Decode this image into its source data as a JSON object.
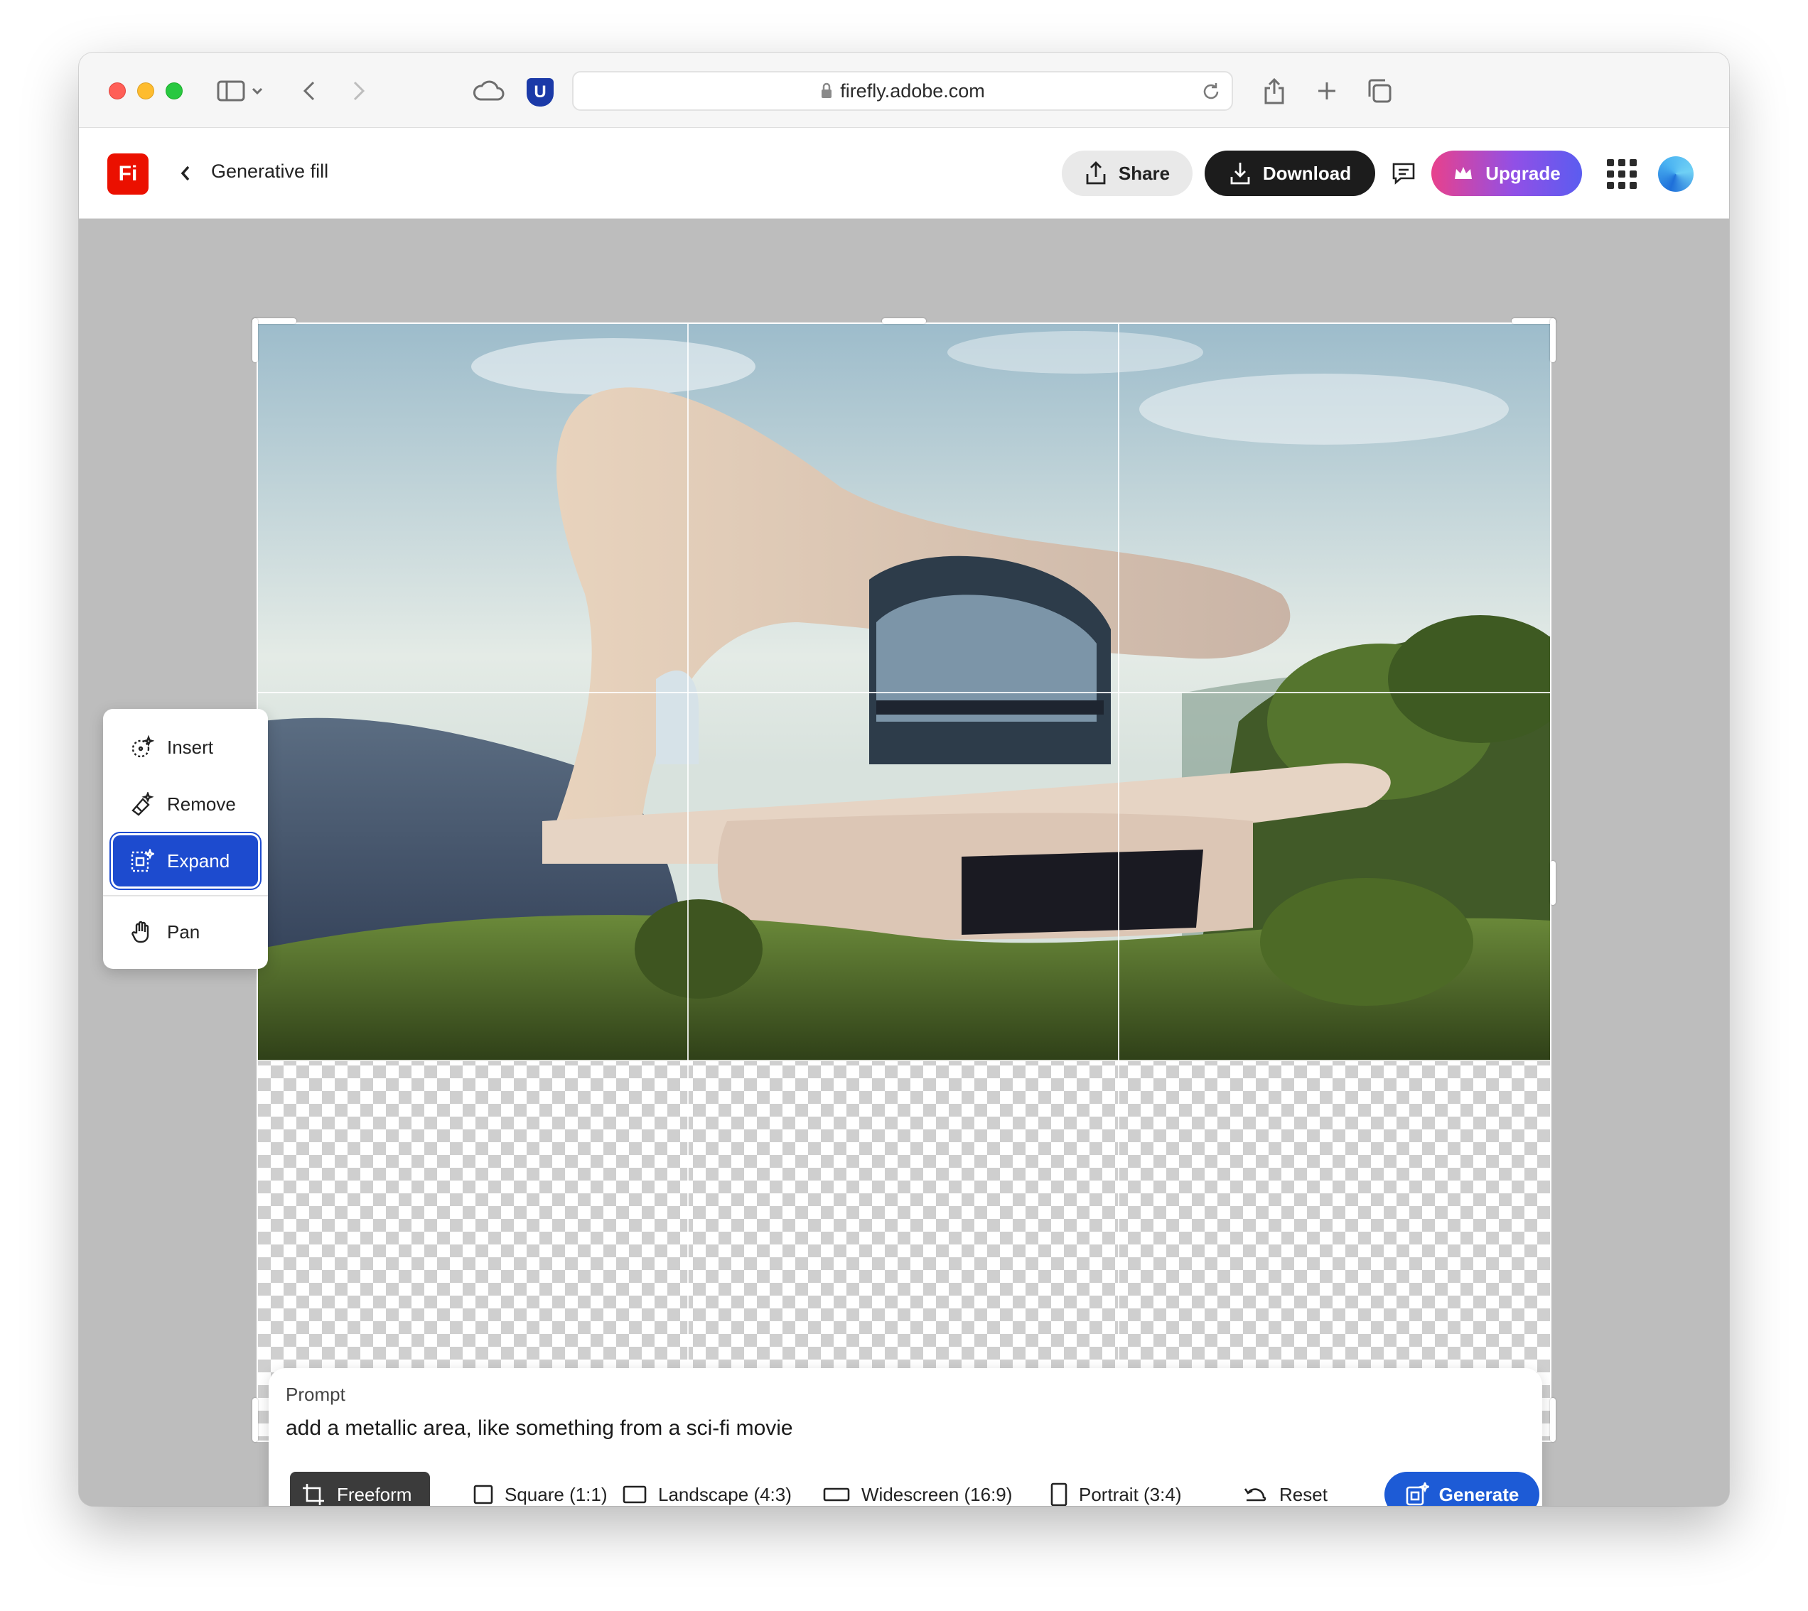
{
  "browser": {
    "url": "firefly.adobe.com",
    "extension_badge": "U"
  },
  "header": {
    "logo_text": "Fi",
    "title": "Generative fill",
    "share_label": "Share",
    "download_label": "Download",
    "upgrade_label": "Upgrade"
  },
  "tool_menu": {
    "items": [
      {
        "label": "Insert",
        "icon": "insert-icon",
        "active": false
      },
      {
        "label": "Remove",
        "icon": "remove-icon",
        "active": false
      },
      {
        "label": "Expand",
        "icon": "expand-icon",
        "active": true
      },
      {
        "label": "Pan",
        "icon": "hand-icon",
        "active": false
      }
    ]
  },
  "prompt": {
    "label": "Prompt",
    "value": "add a metallic area, like something from a sci-fi movie"
  },
  "aspect_ratios": {
    "options": [
      "Freeform",
      "Square (1:1)",
      "Landscape (4:3)",
      "Widescreen (16:9)",
      "Portrait (3:4)"
    ],
    "selected": "Freeform",
    "reset_label": "Reset",
    "generate_label": "Generate"
  },
  "colors": {
    "accent": "#1d5bd6",
    "expand_active": "#1d4bcf",
    "logo": "#eb1000"
  }
}
